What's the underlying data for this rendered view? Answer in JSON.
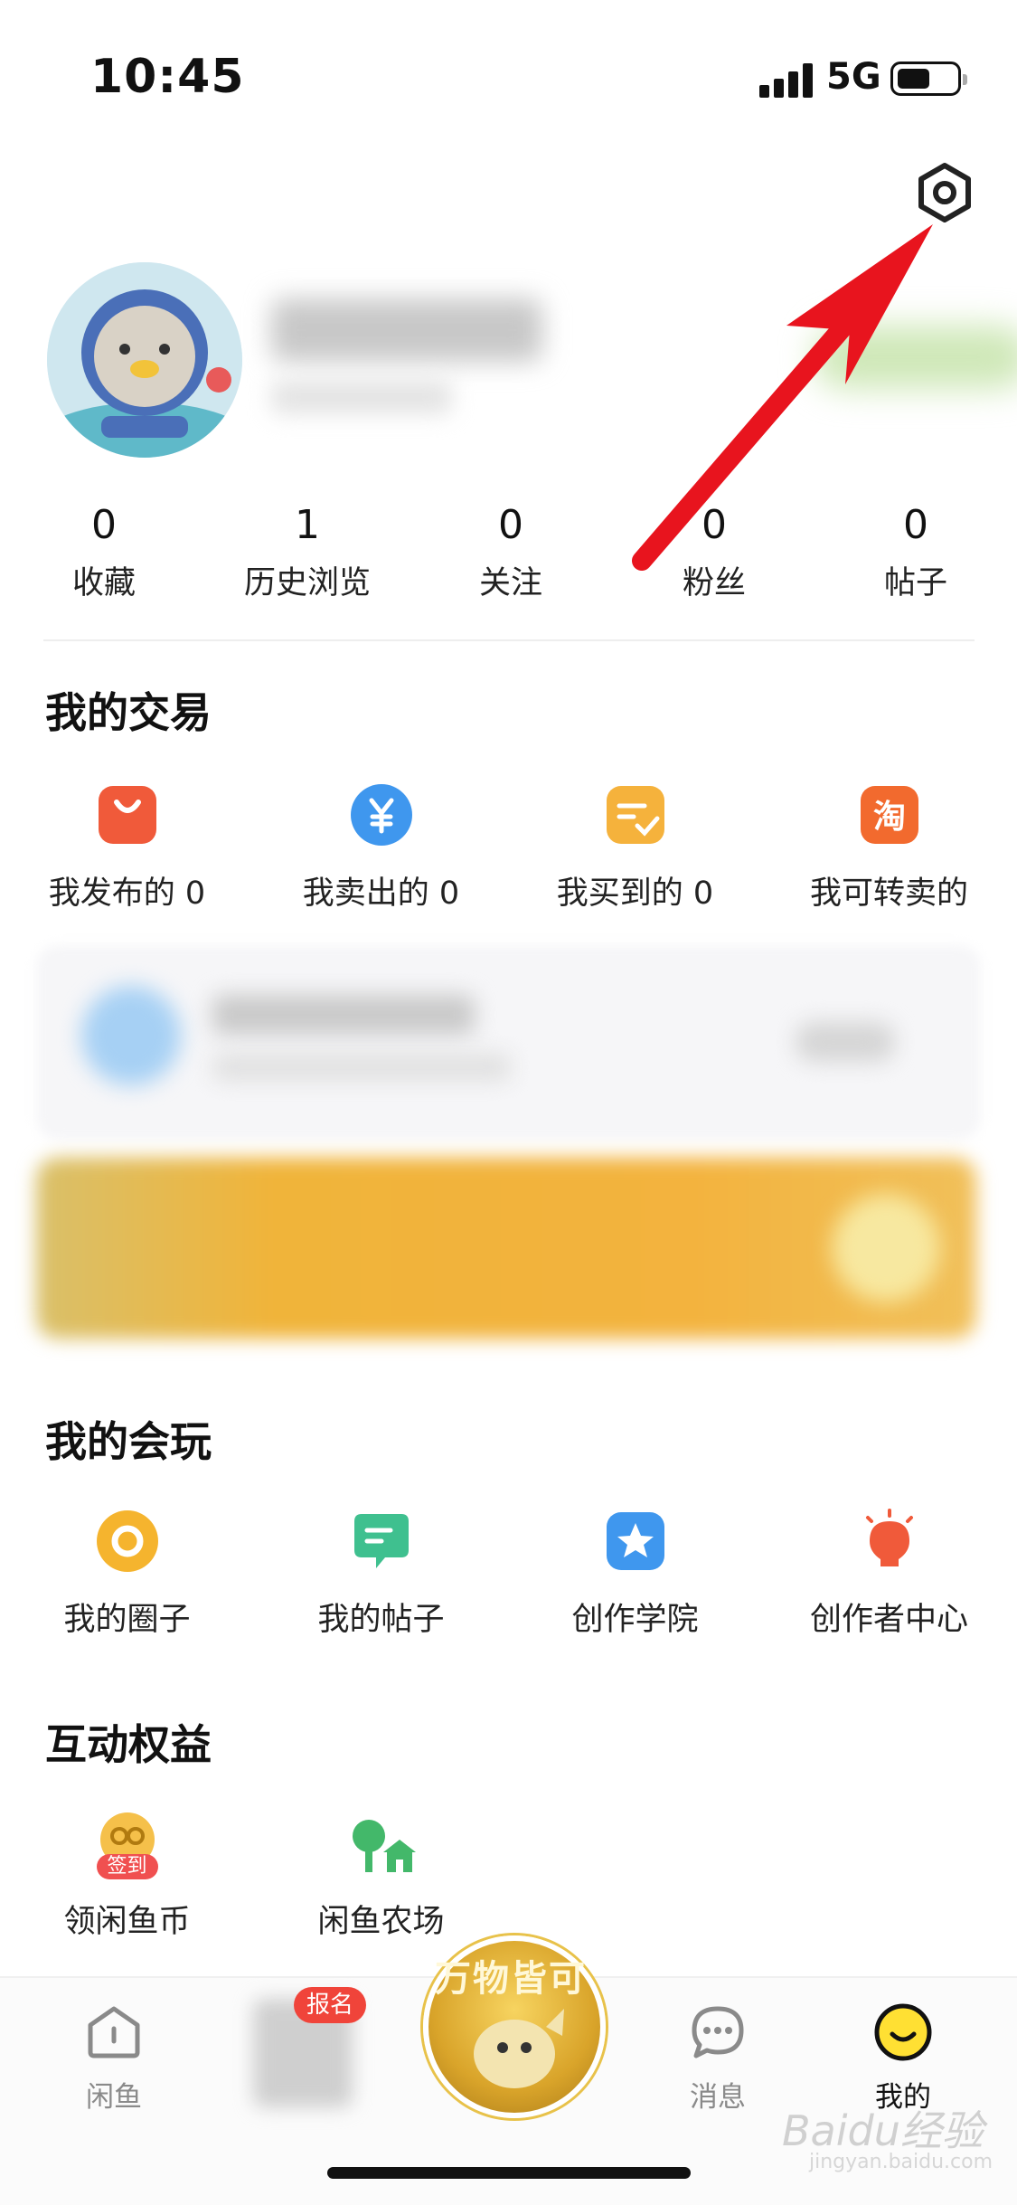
{
  "status_bar": {
    "time": "10:45",
    "network": "5G"
  },
  "profile": {
    "stats": [
      {
        "value": "0",
        "label": "收藏"
      },
      {
        "value": "1",
        "label": "历史浏览"
      },
      {
        "value": "0",
        "label": "关注"
      },
      {
        "value": "0",
        "label": "粉丝"
      },
      {
        "value": "0",
        "label": "帖子"
      }
    ]
  },
  "trade": {
    "title": "我的交易",
    "items": [
      {
        "label": "我发布的 0",
        "icon": "shopping-bag-icon",
        "color": "#f05a3a"
      },
      {
        "label": "我卖出的 0",
        "icon": "yen-icon",
        "color": "#3f97ee"
      },
      {
        "label": "我买到的 0",
        "icon": "order-check-icon",
        "color": "#f5b23c"
      },
      {
        "label": "我可转卖的",
        "icon": "taobao-icon",
        "color": "#f26a2e"
      }
    ]
  },
  "play": {
    "title": "我的会玩",
    "items": [
      {
        "label": "我的圈子",
        "icon": "circle-icon",
        "color": "#f5b42e"
      },
      {
        "label": "我的帖子",
        "icon": "post-icon",
        "color": "#3fc08f"
      },
      {
        "label": "创作学院",
        "icon": "star-icon",
        "color": "#3f97ee"
      },
      {
        "label": "创作者中心",
        "icon": "lightbulb-icon",
        "color": "#f05a3a"
      }
    ]
  },
  "benefits": {
    "title": "互动权益",
    "items": [
      {
        "label": "领闲鱼币",
        "icon": "coin-checkin-icon",
        "badge": "签到"
      },
      {
        "label": "闲鱼农场",
        "icon": "farm-icon"
      }
    ]
  },
  "bottom_nav": {
    "items": [
      {
        "label": "闲鱼",
        "icon": "home-icon"
      },
      {
        "label": "消息",
        "icon": "message-icon"
      },
      {
        "label": "我的",
        "icon": "smile-icon",
        "active": true
      }
    ],
    "center": {
      "label": "万物皆可"
    },
    "badge": "报名"
  },
  "watermark": {
    "text": "Baidu经验",
    "sub": "jingyan.baidu.com"
  },
  "accent_colors": {
    "arrow": "#e8141e",
    "brand_yellow": "#ffe033"
  }
}
